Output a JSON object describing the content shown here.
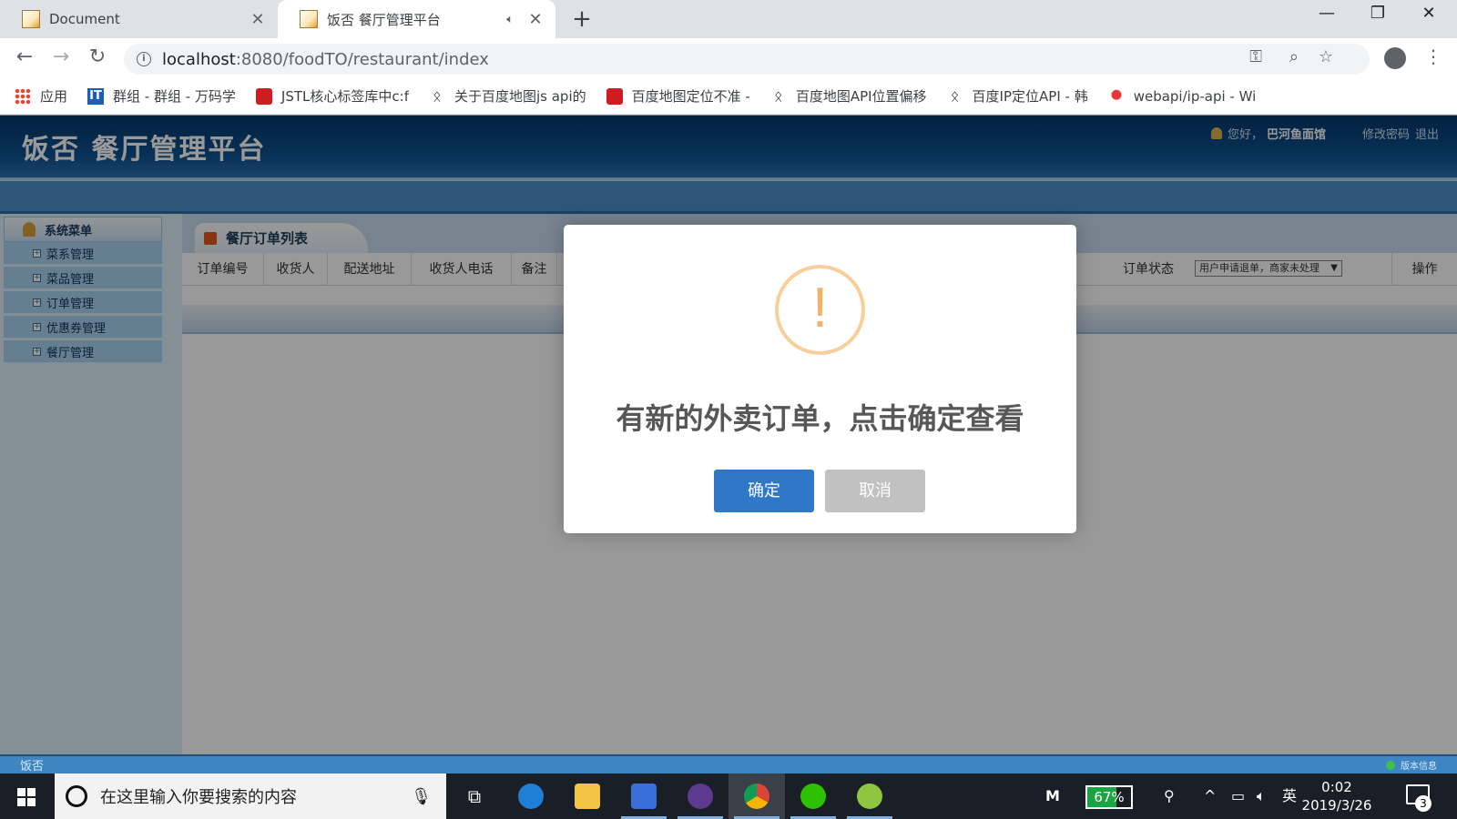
{
  "browser": {
    "tabs": [
      {
        "title": "Document"
      },
      {
        "title": "饭否 餐厅管理平台"
      }
    ],
    "url_host": "localhost",
    "url_path": ":8080/foodTO/restaurant/index",
    "bookmarks": [
      {
        "label": "应用",
        "icon": "apps-icon"
      },
      {
        "label": "群组 - 群组 - 万码学",
        "icon": "group-icon"
      },
      {
        "label": "JSTL核心标签库中c:f",
        "icon": "csdn-icon"
      },
      {
        "label": "关于百度地图js api的",
        "icon": "paw-icon"
      },
      {
        "label": "百度地图定位不准 - ",
        "icon": "csdn-icon"
      },
      {
        "label": "百度地图API位置偏移",
        "icon": "paw-icon"
      },
      {
        "label": "百度IP定位API - 韩",
        "icon": "paw-icon"
      },
      {
        "label": "webapi/ip-api - Wi",
        "icon": "pin-icon"
      }
    ]
  },
  "app": {
    "title": "饭否  餐厅管理平台",
    "greeting": "您好，",
    "user_name": "巴河鱼面馆",
    "change_password": "修改密码",
    "logout": "退出",
    "menu_title": "系统菜单",
    "menu_items": [
      {
        "label": "菜系管理"
      },
      {
        "label": "菜品管理"
      },
      {
        "label": "订单管理"
      },
      {
        "label": "优惠券管理"
      },
      {
        "label": "餐厅管理"
      }
    ],
    "content_tab": "餐厅订单列表",
    "table_headers": [
      "订单编号",
      "收货人",
      "配送地址",
      "收货人电话",
      "备注",
      "订单状态",
      "操作"
    ],
    "status_filter_value": "用户申请退单，商家未处理",
    "footer_left": "饭否",
    "footer_right": "版本信息"
  },
  "dialog": {
    "icon": "!",
    "message": "有新的外卖订单，点击确定查看",
    "ok_label": "确定",
    "cancel_label": "取消"
  },
  "taskbar": {
    "search_placeholder": "在这里输入你要搜索的内容",
    "battery": "67%",
    "ime": "英",
    "time": "0:02",
    "date": "2019/3/26",
    "notification_count": "3"
  }
}
